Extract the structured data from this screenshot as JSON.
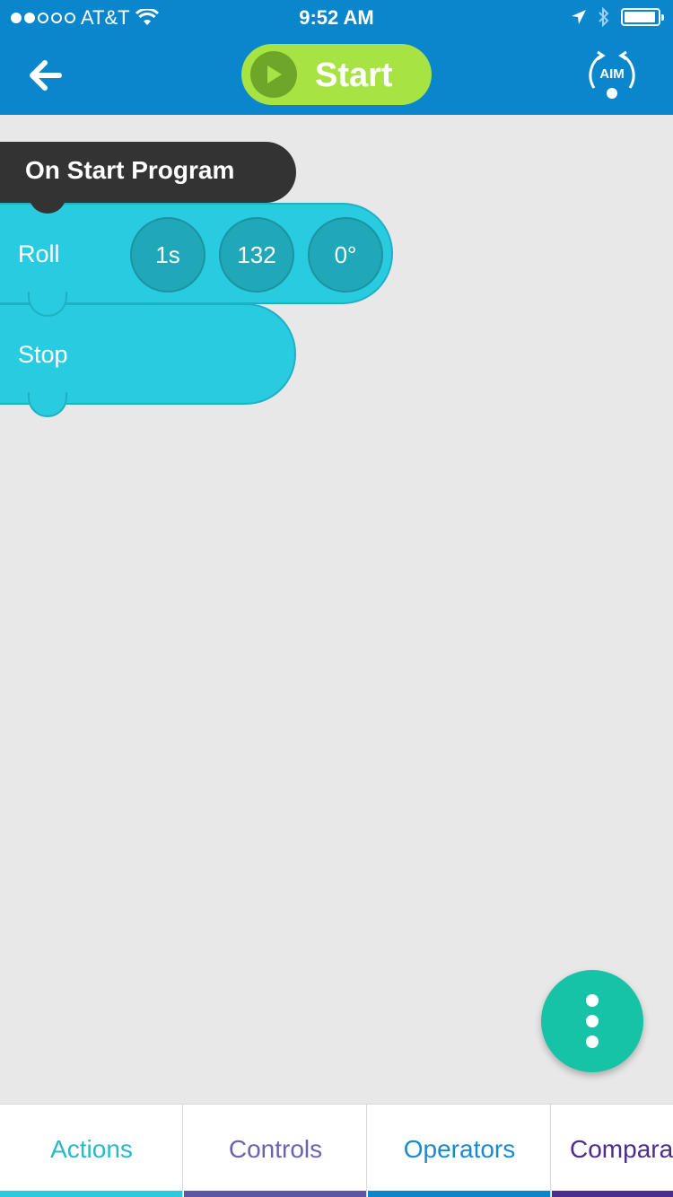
{
  "status_bar": {
    "carrier": "AT&T",
    "time": "9:52 AM"
  },
  "header": {
    "start_label": "Start",
    "aim_label": "AIM"
  },
  "program": {
    "header_label": "On Start Program",
    "blocks": [
      {
        "label": "Roll",
        "params": [
          "1s",
          "132",
          "0°"
        ]
      },
      {
        "label": "Stop"
      }
    ]
  },
  "tabs": [
    {
      "label": "Actions",
      "color": "#29cbe0"
    },
    {
      "label": "Controls",
      "color": "#5b57a6"
    },
    {
      "label": "Operators",
      "color": "#0a86cc"
    },
    {
      "label": "Compara",
      "color": "#4b2d8f"
    }
  ],
  "colors": {
    "header_bg": "#0a86cc",
    "start_button": "#a6e343",
    "block_action": "#29cbe0",
    "block_header": "#333333",
    "fab": "#17c3a7"
  },
  "icons": {
    "back": "arrow-left-icon",
    "play": "play-icon",
    "aim": "aim-icon",
    "more": "more-vertical-icon"
  }
}
